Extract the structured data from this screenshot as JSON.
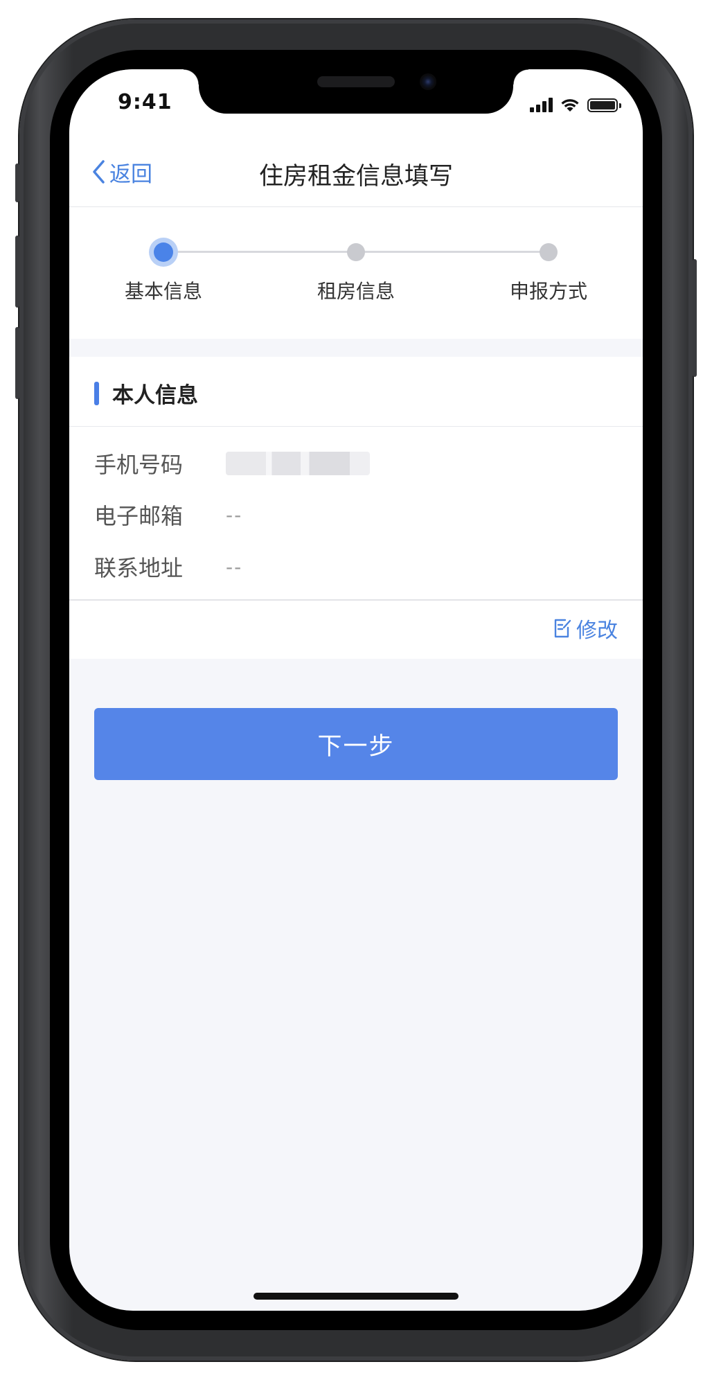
{
  "status_bar": {
    "time": "9:41"
  },
  "nav": {
    "back_label": "返回",
    "title": "住房租金信息填写"
  },
  "steps": [
    {
      "label": "基本信息",
      "active": true
    },
    {
      "label": "租房信息",
      "active": false
    },
    {
      "label": "申报方式",
      "active": false
    }
  ],
  "section": {
    "title": "本人信息",
    "rows": [
      {
        "label": "手机号码",
        "value": ""
      },
      {
        "label": "电子邮箱",
        "value": "--"
      },
      {
        "label": "联系地址",
        "value": "--"
      }
    ],
    "edit_label": "修改"
  },
  "next_button": {
    "label": "下一步"
  },
  "colors": {
    "accent": "#4a83e0",
    "button": "#5585e8",
    "background": "#f5f6fa"
  },
  "icons": {
    "back": "chevron-left-icon",
    "edit": "edit-note-icon",
    "wifi": "wifi-icon",
    "signal": "signal-icon",
    "battery": "battery-icon"
  }
}
